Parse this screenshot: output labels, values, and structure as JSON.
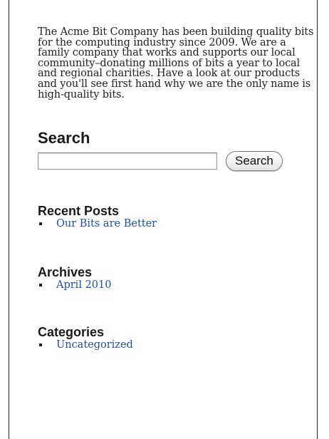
{
  "intro": {
    "text": "The Acme Bit Company has been building quality bits for the computing industry since 2009. We are a family company that works and supports our local community–donating millions of bits a year to local and regional charities. Have a look at our products and you'll see first hand why we are the only name is high-quality bits."
  },
  "search": {
    "title": "Search",
    "input_value": "",
    "button_label": "Search"
  },
  "recent_posts": {
    "title": "Recent Posts",
    "items": [
      {
        "label": "Our Bits are Better"
      }
    ]
  },
  "archives": {
    "title": "Archives",
    "items": [
      {
        "label": "April 2010"
      }
    ]
  },
  "categories": {
    "title": "Categories",
    "items": [
      {
        "label": "Uncategorized"
      }
    ]
  },
  "colors": {
    "link": "#1f4fa6",
    "text": "#222222",
    "border": "#222222"
  }
}
